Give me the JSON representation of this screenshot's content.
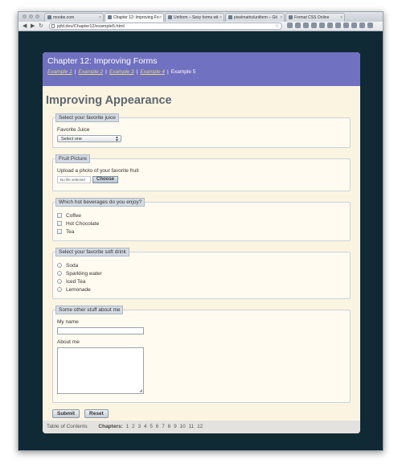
{
  "browser": {
    "tabs": [
      {
        "title": "moobe.com"
      },
      {
        "title": "Chapter 12: Improving Fo"
      },
      {
        "title": "Uniform – Sexy forms wit"
      },
      {
        "title": "pixelmatrix/uniform – Git"
      },
      {
        "title": "Format CSS Online"
      }
    ],
    "url": "jqfd.dev/Chapter12/example5.html"
  },
  "banner": {
    "title": "Chapter 12: Improving Forms",
    "crumbs": [
      "Example 1",
      "Example 2",
      "Example 3",
      "Example 4"
    ],
    "current": "Example 5"
  },
  "page": {
    "title": "Improving Appearance",
    "juice": {
      "legend": "Select your favorite juice",
      "label": "Favorite Juice",
      "selected": "Select one"
    },
    "picture": {
      "legend": "Fruit Picture",
      "label": "Upload a photo of your favorite fruit",
      "file_status": "No file selected",
      "choose": "Choose"
    },
    "hot": {
      "legend": "Which hot beverages do you enjoy?",
      "options": [
        "Coffee",
        "Hot Chocolate",
        "Tea"
      ]
    },
    "soft": {
      "legend": "Select your favorite soft drink",
      "options": [
        "Soda",
        "Sparkling water",
        "Iced Tea",
        "Lemonade"
      ]
    },
    "other": {
      "legend": "Some other stuff about me",
      "name_label": "My name",
      "about_label": "About me"
    },
    "submit": "Submit",
    "reset": "Reset"
  },
  "footer": {
    "toc": "Table of Contents",
    "chapters_label": "Chapters:",
    "chapters": [
      "1",
      "2",
      "3",
      "4",
      "5",
      "6",
      "7",
      "8",
      "9",
      "10",
      "11",
      "12"
    ]
  }
}
